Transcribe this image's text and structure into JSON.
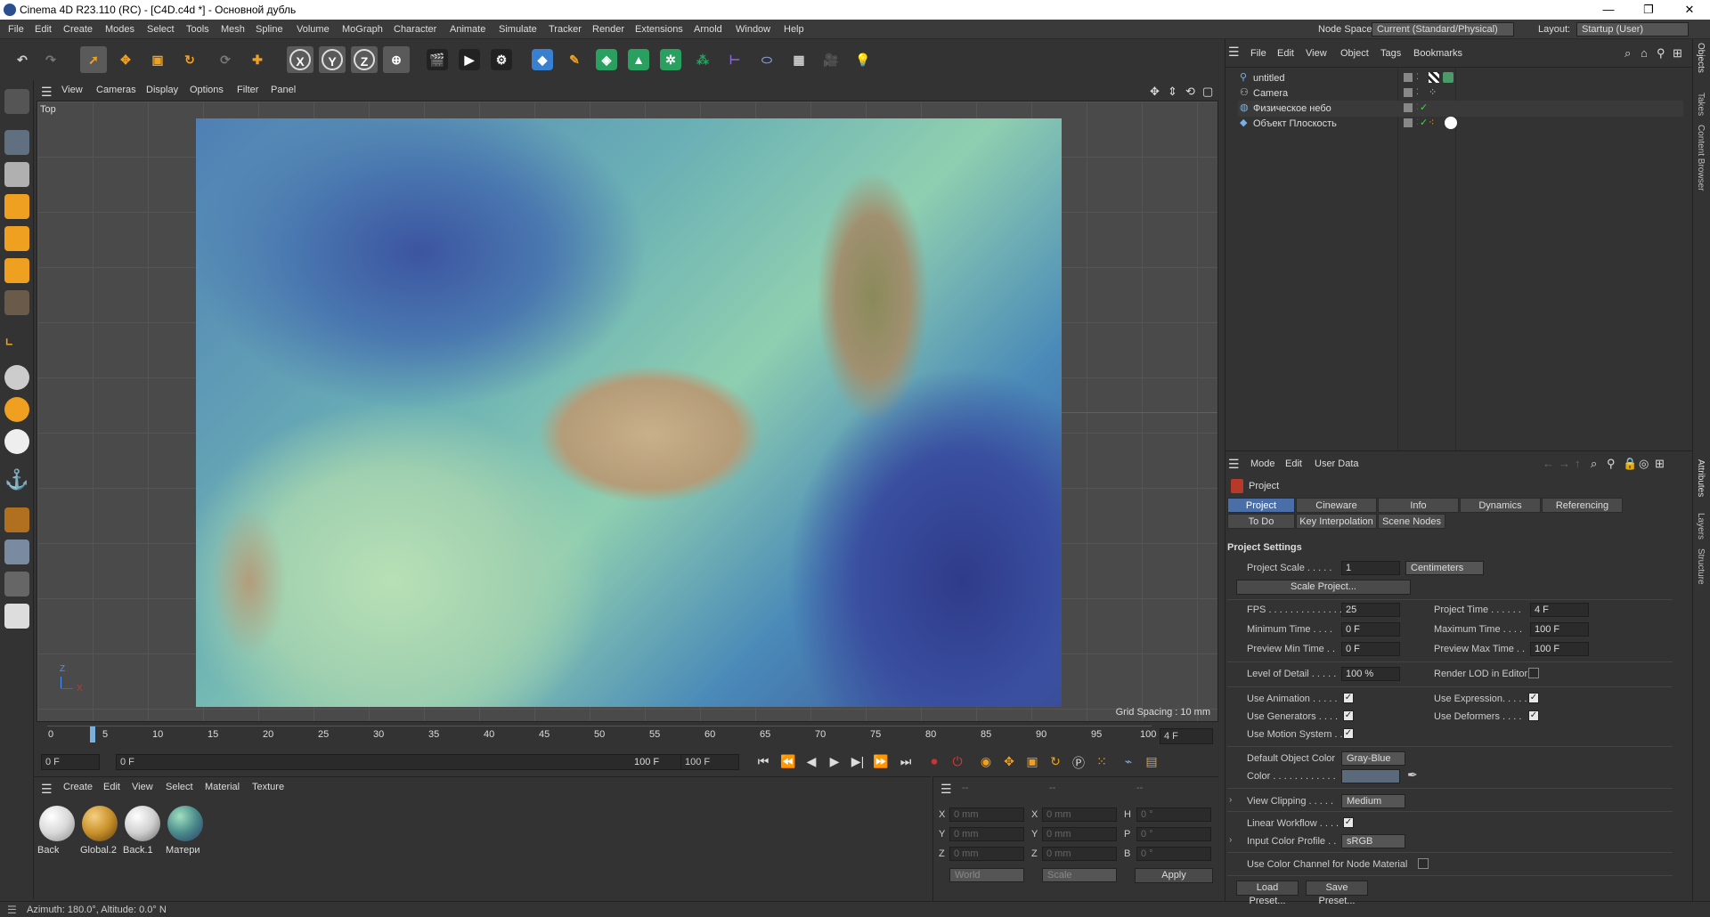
{
  "window": {
    "title": "Cinema 4D R23.110 (RC) - [C4D.c4d *] - Основной дубль",
    "minimize": "—",
    "maximize": "❐",
    "close": "✕"
  },
  "menus": [
    "File",
    "Edit",
    "Create",
    "Modes",
    "Select",
    "Tools",
    "Mesh",
    "Spline",
    "Volume",
    "MoGraph",
    "Character",
    "Animate",
    "Simulate",
    "Tracker",
    "Render",
    "Extensions",
    "Arnold",
    "Window",
    "Help"
  ],
  "nodespace": {
    "label": "Node Space:",
    "value": "Current (Standard/Physical)"
  },
  "layout": {
    "label": "Layout:",
    "value": "Startup (User)"
  },
  "viewport": {
    "menus": [
      "View",
      "Cameras",
      "Display",
      "Options",
      "Filter",
      "Panel"
    ],
    "label": "Top",
    "grid_spacing": "Grid Spacing : 10 mm",
    "axis_z": "Z",
    "axis_x": "X"
  },
  "timeline": {
    "ticks": [
      "0",
      "5",
      "10",
      "15",
      "20",
      "25",
      "30",
      "35",
      "40",
      "45",
      "50",
      "55",
      "60",
      "65",
      "70",
      "75",
      "80",
      "85",
      "90",
      "95",
      "100"
    ],
    "current_frame": "4 F"
  },
  "playback": {
    "start": "0 F",
    "preview_start": "0 F",
    "preview_end": "100 F",
    "end": "100 F"
  },
  "material_manager": {
    "menus": [
      "Create",
      "Edit",
      "View",
      "Select",
      "Material",
      "Texture"
    ],
    "materials": [
      {
        "name": "Back",
        "color": "#e8e8e8"
      },
      {
        "name": "Global.2",
        "color": "#c8902a"
      },
      {
        "name": "Back.1",
        "color": "#cfcfcf"
      },
      {
        "name": "Матери",
        "color": "#4a8a8a"
      }
    ]
  },
  "coordinates": {
    "headers": [
      "--",
      "--",
      "--"
    ],
    "rows": [
      {
        "a": "X",
        "a_val": "0 mm",
        "b": "X",
        "b_val": "0 mm",
        "c": "H",
        "c_val": "0 °"
      },
      {
        "a": "Y",
        "a_val": "0 mm",
        "b": "Y",
        "b_val": "0 mm",
        "c": "P",
        "c_val": "0 °"
      },
      {
        "a": "Z",
        "a_val": "0 mm",
        "b": "Z",
        "b_val": "0 mm",
        "c": "B",
        "c_val": "0 °"
      }
    ],
    "world": "World",
    "scale": "Scale",
    "apply": "Apply"
  },
  "status": "Azimuth: 180.0°, Altitude: 0.0°  N",
  "object_manager": {
    "menus": [
      "File",
      "Edit",
      "View",
      "Object",
      "Tags",
      "Bookmarks"
    ],
    "objects": [
      {
        "name": "untitled"
      },
      {
        "name": "Camera"
      },
      {
        "name": "Физическое небо"
      },
      {
        "name": "Объект Плоскость"
      }
    ]
  },
  "attributes": {
    "menus": [
      "Mode",
      "Edit",
      "User Data"
    ],
    "title": "Project",
    "tabs_row1": [
      "Project Settings",
      "Cineware",
      "Info",
      "Dynamics",
      "Referencing"
    ],
    "tabs_row2": [
      "To Do",
      "Key Interpolation",
      "Scene Nodes"
    ],
    "section": "Project Settings",
    "project_scale": {
      "label": "Project Scale . . . . .",
      "value": "1",
      "unit": "Centimeters"
    },
    "scale_project": "Scale Project...",
    "fps": {
      "label": "FPS . . . . . . . . . . . . . .",
      "value": "25"
    },
    "project_time": {
      "label": "Project Time . . . . . .",
      "value": "4 F"
    },
    "minimum_time": {
      "label": "Minimum Time . . . .",
      "value": "0 F"
    },
    "maximum_time": {
      "label": "Maximum Time . . . .",
      "value": "100 F"
    },
    "preview_min": {
      "label": "Preview Min Time . .",
      "value": "0 F"
    },
    "preview_max": {
      "label": "Preview Max Time . .",
      "value": "100 F"
    },
    "lod": {
      "label": "Level of Detail . . . . .",
      "value": "100 %"
    },
    "render_lod": "Render LOD in Editor",
    "use_animation": "Use Animation . . . . .",
    "use_expression": "Use Expression. . . . .",
    "use_generators": "Use Generators . . . .",
    "use_deformers": "Use Deformers . . . .",
    "use_motion": "Use Motion System . .",
    "default_color": {
      "label": "Default Object Color",
      "value": "Gray-Blue"
    },
    "color": {
      "label": "Color . . . . . . . . . . . ."
    },
    "view_clipping": {
      "label": "View Clipping . . . . .",
      "value": "Medium"
    },
    "linear_workflow": "Linear Workflow . . . .",
    "input_profile": {
      "label": "Input Color Profile . .",
      "value": "sRGB"
    },
    "node_material": "Use Color Channel for Node Material",
    "load_preset": "Load Preset...",
    "save_preset": "Save Preset..."
  },
  "side_tabs": [
    "Objects",
    "Takes",
    "Content Browser",
    "Attributes",
    "Layers",
    "Structure"
  ]
}
